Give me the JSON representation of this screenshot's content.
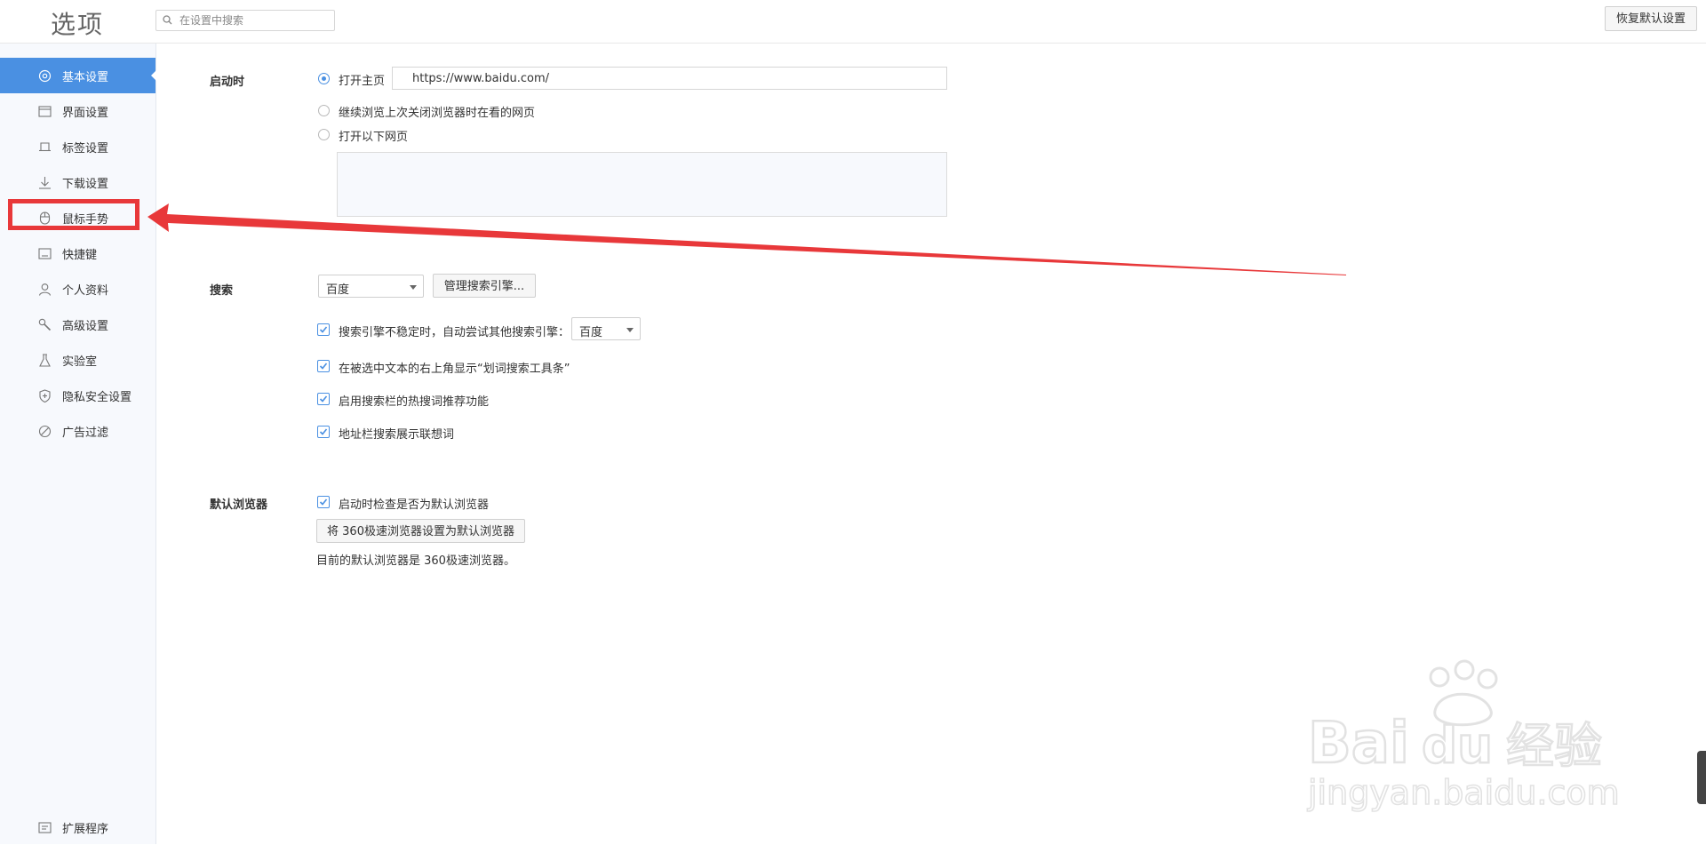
{
  "header": {
    "title": "选项",
    "search_placeholder": "在设置中搜索",
    "reset_label": "恢复默认设置"
  },
  "sidebar": {
    "items": [
      {
        "label": "基本设置",
        "icon": "settings-icon"
      },
      {
        "label": "界面设置",
        "icon": "window-icon"
      },
      {
        "label": "标签设置",
        "icon": "tab-icon"
      },
      {
        "label": "下载设置",
        "icon": "download-icon"
      },
      {
        "label": "鼠标手势",
        "icon": "mouse-icon"
      },
      {
        "label": "快捷键",
        "icon": "keyboard-icon"
      },
      {
        "label": "个人资料",
        "icon": "user-icon"
      },
      {
        "label": "高级设置",
        "icon": "wrench-icon"
      },
      {
        "label": "实验室",
        "icon": "flask-icon"
      },
      {
        "label": "隐私安全设置",
        "icon": "shield-icon"
      },
      {
        "label": "广告过滤",
        "icon": "block-icon"
      }
    ],
    "footer_item": {
      "label": "扩展程序",
      "icon": "extension-icon"
    },
    "active_index": 0
  },
  "startup": {
    "label": "启动时",
    "option_home": "打开主页",
    "home_url": "https://www.baidu.com/",
    "option_continue": "继续浏览上次关闭浏览器时在看的网页",
    "option_pages": "打开以下网页"
  },
  "search": {
    "label": "搜索",
    "engine": "百度",
    "manage_label": "管理搜索引擎...",
    "fallback_text": "搜索引擎不稳定时，自动尝试其他搜索引擎：",
    "fallback_engine": "百度",
    "toolbar_text": "在被选中文本的右上角显示“划词搜索工具条”",
    "hotwords_text": "启用搜索栏的热搜词推荐功能",
    "suggest_text": "地址栏搜索展示联想词"
  },
  "default_browser": {
    "label": "默认浏览器",
    "check_text": "启动时检查是否为默认浏览器",
    "set_button": "将 360极速浏览器设置为默认浏览器",
    "status_text": "目前的默认浏览器是 360极速浏览器。"
  },
  "colors": {
    "accent": "#4a90e2",
    "highlight": "#e8383a"
  }
}
